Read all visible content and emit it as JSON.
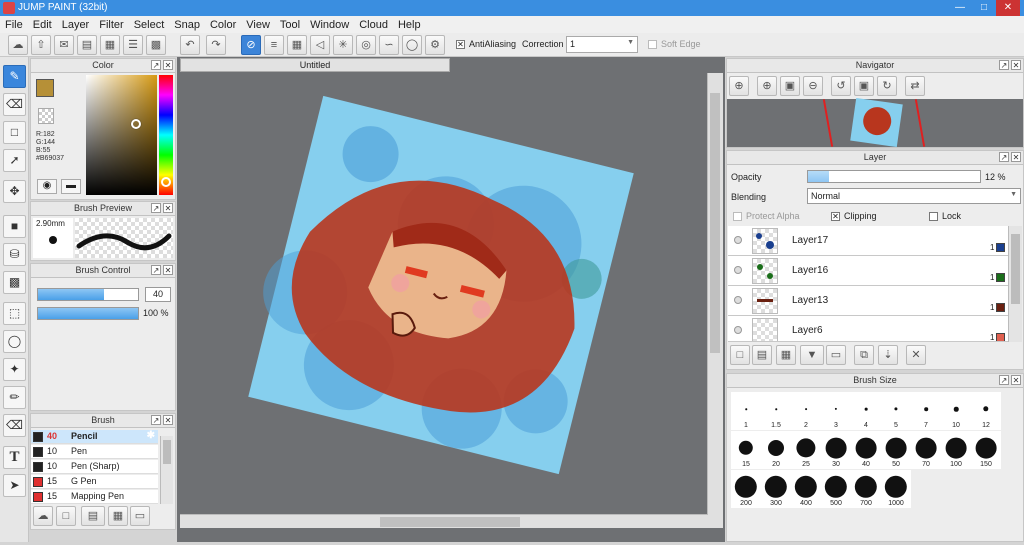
{
  "title": "JUMP PAINT (32bit)",
  "menu": [
    "File",
    "Edit",
    "Layer",
    "Filter",
    "Select",
    "Snap",
    "Color",
    "View",
    "Tool",
    "Window",
    "Cloud",
    "Help"
  ],
  "toolbar": {
    "antialiasing_label": "AntiAliasing",
    "correction_label": "Correction",
    "correction_value": "1",
    "soft_edge_label": "Soft Edge"
  },
  "document_tab": "Untitled",
  "color_panel": {
    "title": "Color",
    "r": "R:182",
    "g": "G:144",
    "b": "B:55",
    "hex": "#B69037",
    "main_color": "#b69037"
  },
  "brush_preview": {
    "title": "Brush Preview",
    "size": "2.90mm"
  },
  "brush_control": {
    "title": "Brush Control",
    "size_value": "40",
    "opacity_value": "100 %",
    "size_fraction": 0.66,
    "opacity_fraction": 1.0
  },
  "brush_panel": {
    "title": "Brush",
    "items": [
      {
        "size": "40",
        "name": "Pencil",
        "color": "#222222"
      },
      {
        "size": "10",
        "name": "Pen",
        "color": "#222222"
      },
      {
        "size": "10",
        "name": "Pen (Sharp)",
        "color": "#222222"
      },
      {
        "size": "15",
        "name": "G Pen",
        "color": "#e03030"
      },
      {
        "size": "15",
        "name": "Mapping Pen",
        "color": "#e03030"
      }
    ]
  },
  "navigator": {
    "title": "Navigator"
  },
  "layer_panel": {
    "title": "Layer",
    "opacity_label": "Opacity",
    "opacity_value": "12 %",
    "opacity_fraction": 0.12,
    "blending_label": "Blending",
    "blending_value": "Normal",
    "protect_alpha": "Protect Alpha",
    "clipping": "Clipping",
    "lock": "Lock",
    "layers": [
      {
        "name": "Layer17",
        "num": "1",
        "color": "#1a3f8f"
      },
      {
        "name": "Layer16",
        "num": "1",
        "color": "#1a6e1a"
      },
      {
        "name": "Layer13",
        "num": "1",
        "color": "#6a2010"
      },
      {
        "name": "Layer6",
        "num": "1",
        "color": "#e06050"
      }
    ]
  },
  "brush_size": {
    "title": "Brush Size",
    "sizes": [
      "1",
      "1.5",
      "2",
      "3",
      "4",
      "5",
      "7",
      "10",
      "12",
      "15",
      "20",
      "25",
      "30",
      "40",
      "50",
      "70",
      "100",
      "150",
      "200",
      "300",
      "400",
      "500",
      "700",
      "1000"
    ]
  }
}
